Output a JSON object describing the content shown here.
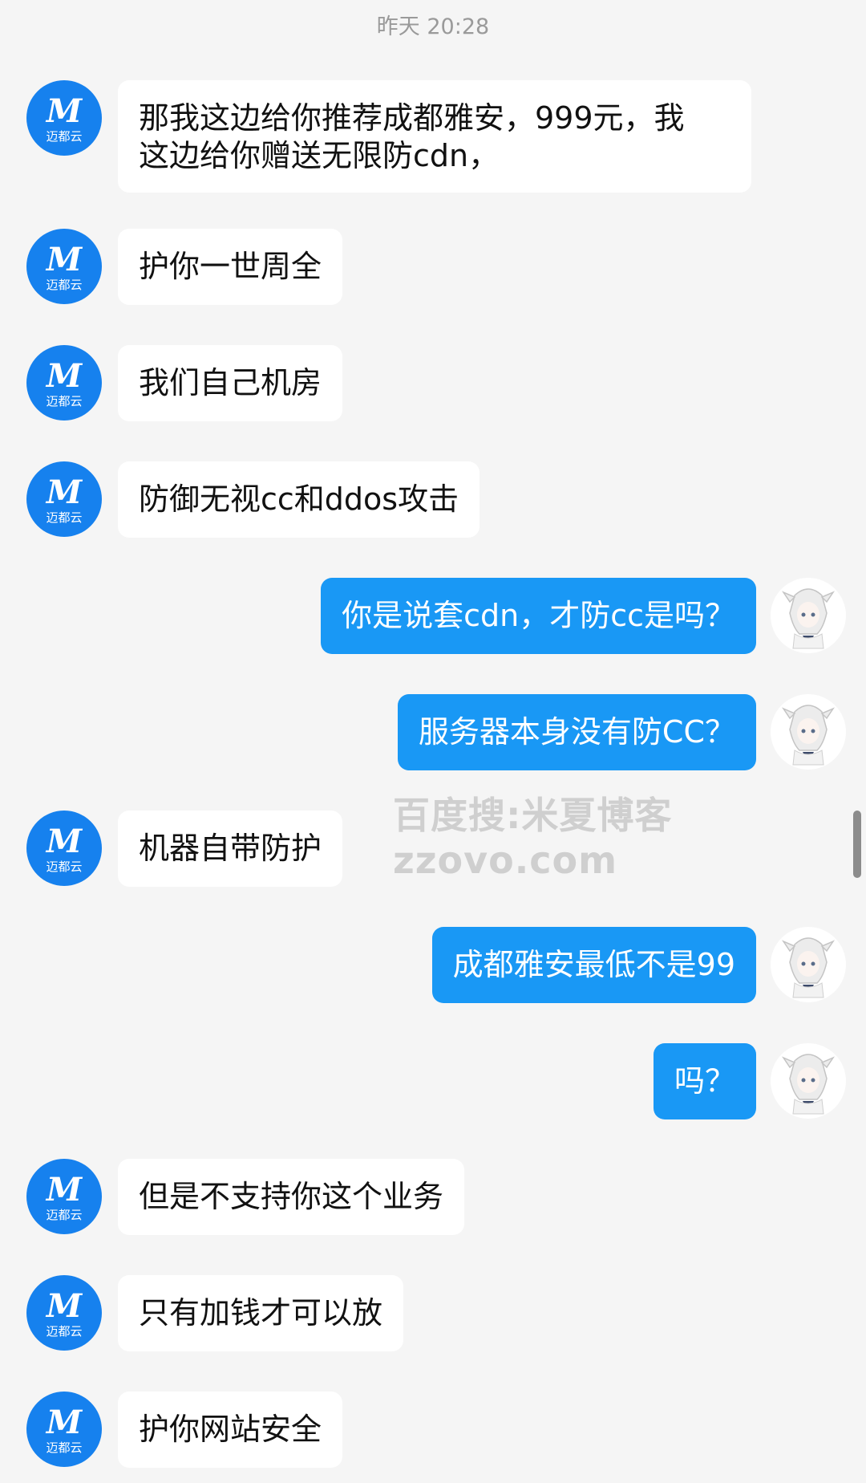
{
  "timestamp": "昨天 20:28",
  "watermark": {
    "line1": "百度搜:米夏博客",
    "line2": "zzovo.com"
  },
  "bot": {
    "avatar_icon": "maidu-cloud-logo-icon",
    "avatar_logo_letter": "M",
    "avatar_logo_text": "迈都云",
    "brand_color": "#1681ee"
  },
  "user": {
    "avatar_icon": "anime-girl-avatar-icon",
    "bubble_color": "#1998f5"
  },
  "messages": [
    {
      "from": "bot",
      "text": "那我这边给你推荐成都雅安，999元，我\n这边给你赠送无限防cdn，"
    },
    {
      "from": "bot",
      "text": "护你一世周全"
    },
    {
      "from": "bot",
      "text": "我们自己机房"
    },
    {
      "from": "bot",
      "text": "防御无视cc和ddos攻击"
    },
    {
      "from": "user",
      "text": "你是说套cdn，才防cc是吗？"
    },
    {
      "from": "user",
      "text": "服务器本身没有防CC？"
    },
    {
      "from": "bot",
      "text": "机器自带防护"
    },
    {
      "from": "user",
      "text": "成都雅安最低不是99"
    },
    {
      "from": "user",
      "text": "吗？"
    },
    {
      "from": "bot",
      "text": "但是不支持你这个业务"
    },
    {
      "from": "bot",
      "text": "只有加钱才可以放"
    },
    {
      "from": "bot",
      "text": "护你网站安全"
    }
  ]
}
